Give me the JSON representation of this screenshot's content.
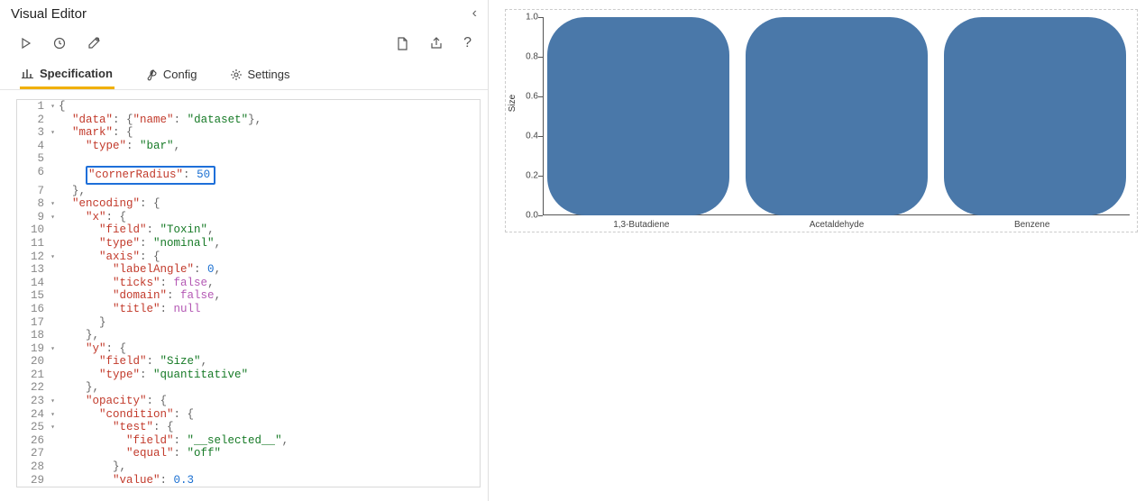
{
  "header": {
    "title": "Visual Editor"
  },
  "tabs": [
    {
      "label": "Specification",
      "active": true
    },
    {
      "label": "Config",
      "active": false
    },
    {
      "label": "Settings",
      "active": false
    }
  ],
  "code": {
    "lines": [
      {
        "n": 1,
        "fold": true,
        "indent": 0,
        "tokens": [
          [
            "punct",
            "{"
          ]
        ]
      },
      {
        "n": 2,
        "fold": false,
        "indent": 1,
        "tokens": [
          [
            "key",
            "\"data\""
          ],
          [
            "punct",
            ": {"
          ],
          [
            "key",
            "\"name\""
          ],
          [
            "punct",
            ": "
          ],
          [
            "str",
            "\"dataset\""
          ],
          [
            "punct",
            "},"
          ]
        ]
      },
      {
        "n": 3,
        "fold": true,
        "indent": 1,
        "tokens": [
          [
            "key",
            "\"mark\""
          ],
          [
            "punct",
            ": {"
          ]
        ]
      },
      {
        "n": 4,
        "fold": false,
        "indent": 2,
        "tokens": [
          [
            "key",
            "\"type\""
          ],
          [
            "punct",
            ": "
          ],
          [
            "str",
            "\"bar\""
          ],
          [
            "punct",
            ","
          ]
        ]
      },
      {
        "n": 5,
        "fold": false,
        "indent": 2,
        "tokens": [],
        "obscured": true
      },
      {
        "n": 6,
        "fold": false,
        "indent": 2,
        "tokens": [
          [
            "key",
            "\"cornerRadius\""
          ],
          [
            "punct",
            ": "
          ],
          [
            "num",
            "50"
          ]
        ],
        "highlight": true
      },
      {
        "n": 7,
        "fold": false,
        "indent": 1,
        "tokens": [
          [
            "punct",
            "},"
          ]
        ]
      },
      {
        "n": 8,
        "fold": true,
        "indent": 1,
        "tokens": [
          [
            "key",
            "\"encoding\""
          ],
          [
            "punct",
            ": {"
          ]
        ]
      },
      {
        "n": 9,
        "fold": true,
        "indent": 2,
        "tokens": [
          [
            "key",
            "\"x\""
          ],
          [
            "punct",
            ": {"
          ]
        ]
      },
      {
        "n": 10,
        "fold": false,
        "indent": 3,
        "tokens": [
          [
            "key",
            "\"field\""
          ],
          [
            "punct",
            ": "
          ],
          [
            "str",
            "\"Toxin\""
          ],
          [
            "punct",
            ","
          ]
        ]
      },
      {
        "n": 11,
        "fold": false,
        "indent": 3,
        "tokens": [
          [
            "key",
            "\"type\""
          ],
          [
            "punct",
            ": "
          ],
          [
            "str",
            "\"nominal\""
          ],
          [
            "punct",
            ","
          ]
        ]
      },
      {
        "n": 12,
        "fold": true,
        "indent": 3,
        "tokens": [
          [
            "key",
            "\"axis\""
          ],
          [
            "punct",
            ": {"
          ]
        ]
      },
      {
        "n": 13,
        "fold": false,
        "indent": 4,
        "tokens": [
          [
            "key",
            "\"labelAngle\""
          ],
          [
            "punct",
            ": "
          ],
          [
            "num",
            "0"
          ],
          [
            "punct",
            ","
          ]
        ]
      },
      {
        "n": 14,
        "fold": false,
        "indent": 4,
        "tokens": [
          [
            "key",
            "\"ticks\""
          ],
          [
            "punct",
            ": "
          ],
          [
            "bool",
            "false"
          ],
          [
            "punct",
            ","
          ]
        ]
      },
      {
        "n": 15,
        "fold": false,
        "indent": 4,
        "tokens": [
          [
            "key",
            "\"domain\""
          ],
          [
            "punct",
            ": "
          ],
          [
            "bool",
            "false"
          ],
          [
            "punct",
            ","
          ]
        ]
      },
      {
        "n": 16,
        "fold": false,
        "indent": 4,
        "tokens": [
          [
            "key",
            "\"title\""
          ],
          [
            "punct",
            ": "
          ],
          [
            "null",
            "null"
          ]
        ]
      },
      {
        "n": 17,
        "fold": false,
        "indent": 3,
        "tokens": [
          [
            "punct",
            "}"
          ]
        ]
      },
      {
        "n": 18,
        "fold": false,
        "indent": 2,
        "tokens": [
          [
            "punct",
            "},"
          ]
        ]
      },
      {
        "n": 19,
        "fold": true,
        "indent": 2,
        "tokens": [
          [
            "key",
            "\"y\""
          ],
          [
            "punct",
            ": {"
          ]
        ]
      },
      {
        "n": 20,
        "fold": false,
        "indent": 3,
        "tokens": [
          [
            "key",
            "\"field\""
          ],
          [
            "punct",
            ": "
          ],
          [
            "str",
            "\"Size\""
          ],
          [
            "punct",
            ","
          ]
        ]
      },
      {
        "n": 21,
        "fold": false,
        "indent": 3,
        "tokens": [
          [
            "key",
            "\"type\""
          ],
          [
            "punct",
            ": "
          ],
          [
            "str",
            "\"quantitative\""
          ]
        ]
      },
      {
        "n": 22,
        "fold": false,
        "indent": 2,
        "tokens": [
          [
            "punct",
            "},"
          ]
        ]
      },
      {
        "n": 23,
        "fold": true,
        "indent": 2,
        "tokens": [
          [
            "key",
            "\"opacity\""
          ],
          [
            "punct",
            ": {"
          ]
        ]
      },
      {
        "n": 24,
        "fold": true,
        "indent": 3,
        "tokens": [
          [
            "key",
            "\"condition\""
          ],
          [
            "punct",
            ": {"
          ]
        ]
      },
      {
        "n": 25,
        "fold": true,
        "indent": 4,
        "tokens": [
          [
            "key",
            "\"test\""
          ],
          [
            "punct",
            ": {"
          ]
        ]
      },
      {
        "n": 26,
        "fold": false,
        "indent": 5,
        "tokens": [
          [
            "key",
            "\"field\""
          ],
          [
            "punct",
            ": "
          ],
          [
            "str",
            "\"__selected__\""
          ],
          [
            "punct",
            ","
          ]
        ]
      },
      {
        "n": 27,
        "fold": false,
        "indent": 5,
        "tokens": [
          [
            "key",
            "\"equal\""
          ],
          [
            "punct",
            ": "
          ],
          [
            "str",
            "\"off\""
          ]
        ]
      },
      {
        "n": 28,
        "fold": false,
        "indent": 4,
        "tokens": [
          [
            "punct",
            "},"
          ]
        ]
      },
      {
        "n": 29,
        "fold": false,
        "indent": 4,
        "tokens": [
          [
            "key",
            "\"value\""
          ],
          [
            "punct",
            ": "
          ],
          [
            "num",
            "0.3"
          ]
        ]
      }
    ]
  },
  "chart_data": {
    "type": "bar",
    "categories": [
      "1,3-Butadiene",
      "Acetaldehyde",
      "Benzene"
    ],
    "values": [
      1.0,
      1.0,
      1.0
    ],
    "ylabel": "Size",
    "xlabel": "",
    "ylim": [
      0.0,
      1.0
    ],
    "yticks": [
      0.0,
      0.2,
      0.4,
      0.6,
      0.8,
      1.0
    ],
    "corner_radius": 50,
    "bar_color": "#4a78a9"
  }
}
